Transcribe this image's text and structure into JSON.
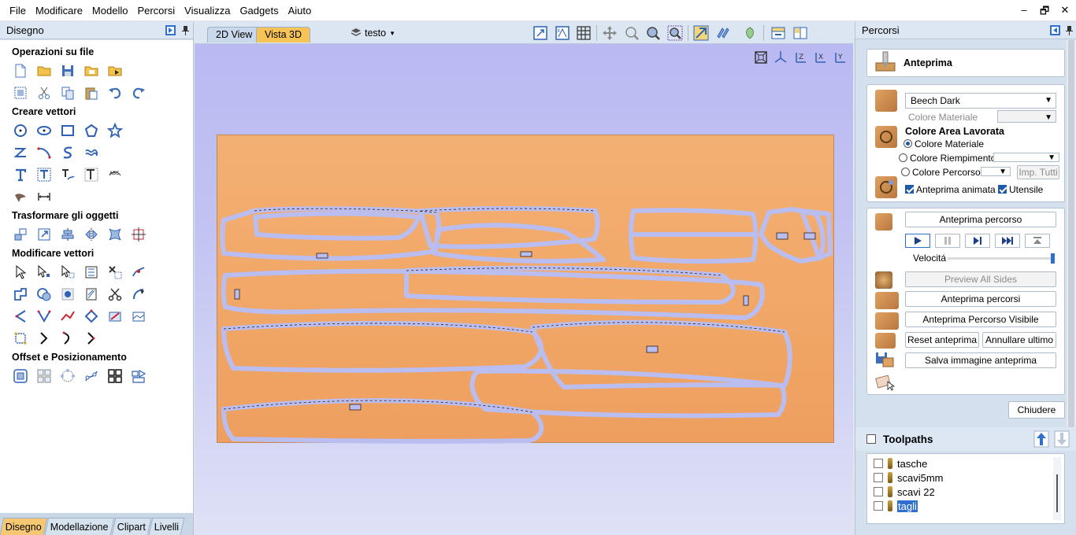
{
  "menu": [
    "File",
    "Modificare",
    "Modello",
    "Percorsi",
    "Visualizza",
    "Gadgets",
    "Aiuto"
  ],
  "window_controls": [
    "–",
    "🗗",
    "✕"
  ],
  "left_panel": {
    "title": "Disegno",
    "sections": [
      {
        "title": "Operazioni su file"
      },
      {
        "title": "Creare vettori"
      },
      {
        "title": "Trasformare gli oggetti"
      },
      {
        "title": "Modificare vettori"
      },
      {
        "title": "Offset e Posizionamento"
      }
    ],
    "bottom_tabs": [
      "Disegno",
      "Modellazione",
      "Clipart",
      "Livelli"
    ]
  },
  "view": {
    "tabs": [
      "2D View",
      "Vista 3D"
    ],
    "active_tab": "Vista 3D",
    "layer": "testo",
    "axis_labels": [
      "Z",
      "X",
      "Y"
    ],
    "background_colors": [
      "#b9b8f3",
      "#dfe1f6"
    ],
    "board_color": "#f1a868",
    "path_color": "#b9bdf0"
  },
  "right_panel": {
    "title": "Percorsi",
    "preview_title": "Anteprima",
    "material": "Beech Dark",
    "colore_materiale_label": "Colore Materiale",
    "area_title": "Colore Area Lavorata",
    "radio_options": [
      "Colore Materiale",
      "Colore Riempimento",
      "Colore Percorso"
    ],
    "imp_tutti": "Imp. Tutti",
    "anteprima_animata": "Anteprima animata",
    "utensile": "Utensile",
    "anteprima_percorso": "Anteprima percorso",
    "velocita": "Velocitá",
    "speed": 1.0,
    "preview_all_sides": "Preview All Sides",
    "anteprima_percorsi": "Anteprima percorsi",
    "anteprima_visibile": "Anteprima Percorso Visibile",
    "reset_anteprima": "Reset anteprima",
    "annullare_ultimo": "Annullare ultimo",
    "salva_immagine": "Salva immagine anteprima",
    "chiudere": "Chiudere",
    "toolpaths_title": "Toolpaths",
    "toolpaths": [
      "tasche",
      "scavi5mm",
      "scavi 22",
      "tagli"
    ],
    "selected_toolpath": "tagli"
  }
}
